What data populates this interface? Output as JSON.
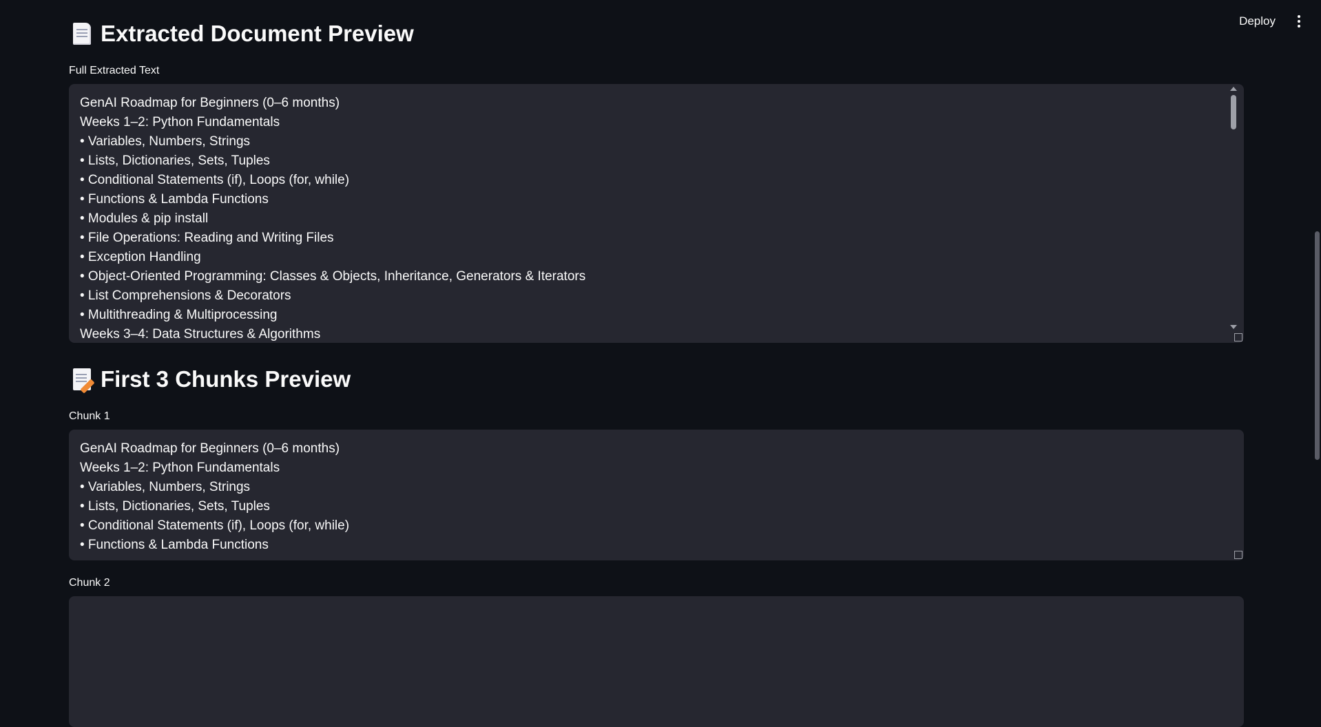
{
  "header": {
    "deploy_label": "Deploy"
  },
  "extracted": {
    "title": "Extracted Document Preview",
    "field_label": "Full Extracted Text",
    "lines": [
      "GenAI Roadmap for Beginners (0–6 months)",
      "Weeks 1–2: Python Fundamentals",
      "• Variables, Numbers, Strings",
      "• Lists, Dictionaries, Sets, Tuples",
      "• Conditional Statements (if), Loops (for, while)",
      "• Functions & Lambda Functions",
      "• Modules & pip install",
      "• File Operations: Reading and Writing Files",
      "• Exception Handling",
      "• Object-Oriented Programming: Classes & Objects, Inheritance, Generators & Iterators",
      "• List Comprehensions & Decorators",
      "• Multithreading & Multiprocessing",
      "Weeks 3–4: Data Structures & Algorithms"
    ]
  },
  "chunks": {
    "title": "First 3 Chunks Preview",
    "chunk1_label": "Chunk 1",
    "chunk1_lines": [
      "GenAI Roadmap for Beginners (0–6 months)",
      "Weeks 1–2: Python Fundamentals",
      "• Variables, Numbers, Strings",
      "• Lists, Dictionaries, Sets, Tuples",
      "• Conditional Statements (if), Loops (for, while)",
      "• Functions & Lambda Functions"
    ],
    "chunk2_label": "Chunk 2"
  },
  "icons": {
    "extracted_title_icon": "page-facing-up-icon",
    "chunks_title_icon": "memo-icon",
    "menu_icon": "kebab-menu-icon"
  }
}
